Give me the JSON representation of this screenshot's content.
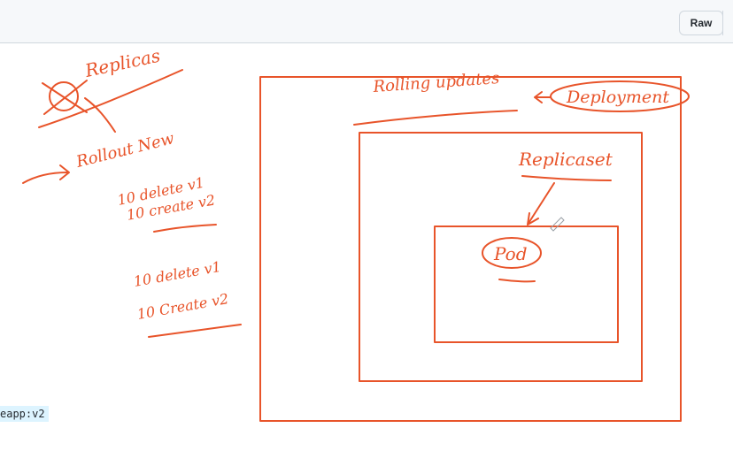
{
  "toolbar": {
    "raw_label": "Raw"
  },
  "snippet": {
    "text": "eapp:v2"
  },
  "whiteboard": {
    "notes": {
      "replicas": "Replicas",
      "rollout_new": "Rollout New",
      "steps": [
        "10 delete v1",
        "10 create v2",
        "10 delete v1",
        "10 Create v2"
      ]
    },
    "labels": {
      "rolling_updates": "Rolling updates",
      "deployment": "Deployment",
      "replicaset": "Replicaset",
      "pod": "Pod"
    },
    "ink_color": "#e8542a"
  }
}
